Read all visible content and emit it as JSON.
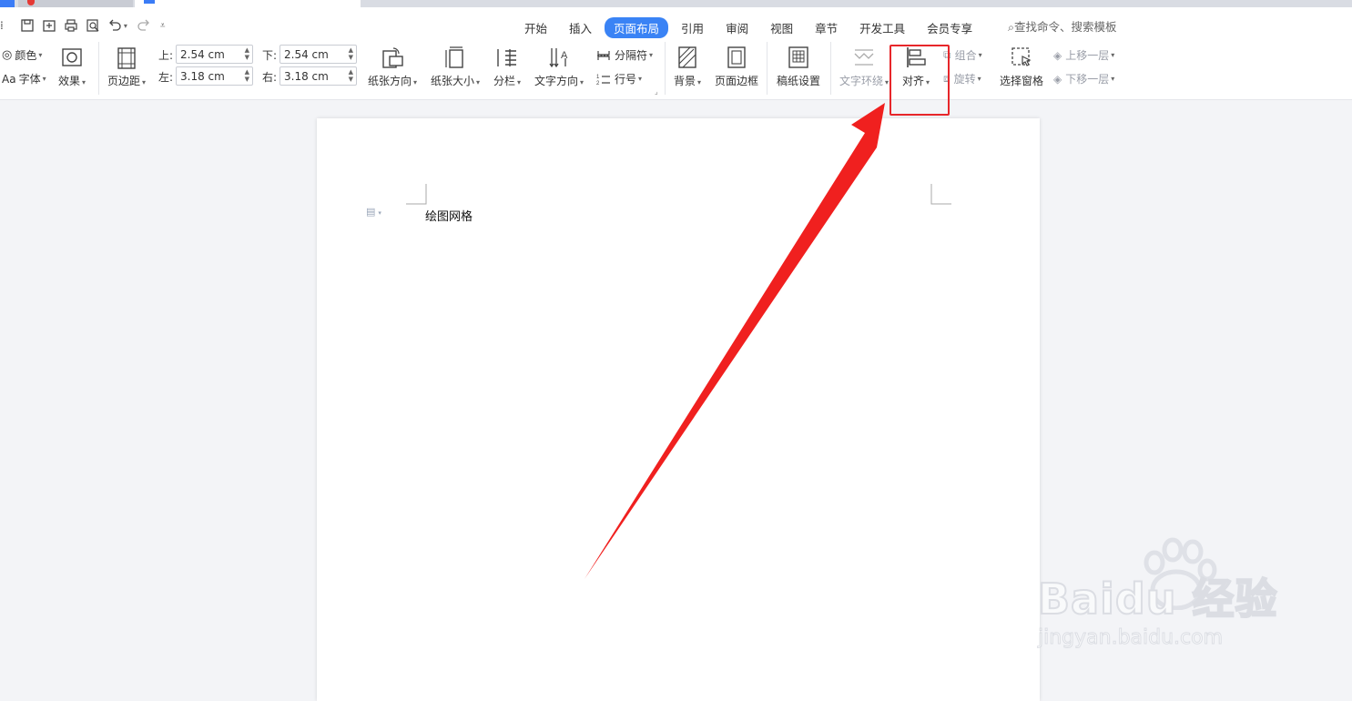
{
  "menu": {
    "tabs": [
      "开始",
      "插入",
      "页面布局",
      "引用",
      "审阅",
      "视图",
      "章节",
      "开发工具",
      "会员专享"
    ],
    "active_tab": "页面布局",
    "search_placeholder": "查找命令、搜索模板"
  },
  "ribbon": {
    "theme_color": "颜色",
    "theme_font": "字体",
    "theme_font_prefix": "Aa",
    "theme_effect": "效果",
    "margins": "页边距",
    "margin_top_label": "上:",
    "margin_top_value": "2.54 cm",
    "margin_bottom_label": "下:",
    "margin_bottom_value": "2.54 cm",
    "margin_left_label": "左:",
    "margin_left_value": "3.18 cm",
    "margin_right_label": "右:",
    "margin_right_value": "3.18 cm",
    "orientation": "纸张方向",
    "paper_size": "纸张大小",
    "columns": "分栏",
    "text_direction": "文字方向",
    "breaks": "分隔符",
    "line_numbers": "行号",
    "background": "背景",
    "page_border": "页面边框",
    "manuscript": "稿纸设置",
    "wrap_text": "文字环绕",
    "align": "对齐",
    "group": "组合",
    "rotate": "旋转",
    "selection_pane": "选择窗格",
    "bring_forward": "上移一层",
    "send_backward": "下移一层"
  },
  "document": {
    "first_line": "绘图网格"
  },
  "watermark": {
    "brand": "Baidu 经验",
    "url": "jingyan.baidu.com"
  },
  "colors": {
    "accent": "#3a83f5",
    "highlight": "#e7262a"
  }
}
